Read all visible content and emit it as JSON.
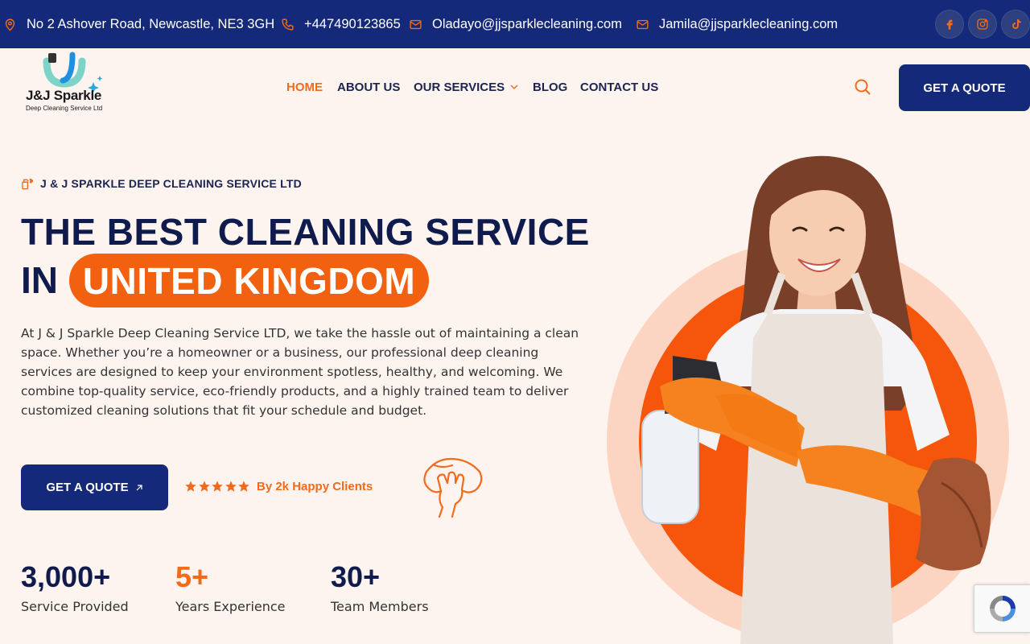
{
  "topbar": {
    "address": "No 2 Ashover Road, Newcastle, NE3 3GH",
    "phone": "+447490123865",
    "email1": "Oladayo@jjsparklecleaning.com",
    "email2": "Jamila@jjsparklecleaning.com",
    "social": [
      "facebook-icon",
      "instagram-icon",
      "tiktok-icon"
    ],
    "bg_color": "#14297a",
    "icon_color": "#f26a1b"
  },
  "logo": {
    "name": "J&J Sparkle",
    "subtitle": "Deep Cleaning Service Ltd"
  },
  "nav": {
    "items": [
      {
        "label": "HOME",
        "active": true
      },
      {
        "label": "ABOUT US",
        "active": false
      },
      {
        "label": "OUR SERVICES",
        "active": false,
        "dropdown": true
      },
      {
        "label": "BLOG",
        "active": false
      },
      {
        "label": "CONTACT US",
        "active": false
      }
    ],
    "cta": "GET A QUOTE"
  },
  "hero": {
    "tagline": "J & J SPARKLE DEEP CLEANING SERVICE LTD",
    "title_line1": "THE BEST CLEANING SERVICE",
    "title_line2_prefix": "IN",
    "title_highlight": "UNITED KINGDOM",
    "description": "At J & J Sparkle Deep Cleaning Service LTD, we take the hassle out of maintaining a clean space. Whether you’re a homeowner or a business, our professional deep cleaning services are designed to keep your environment spotless, healthy, and welcoming. We combine top-quality service, eco-friendly products, and a highly trained team to deliver customized cleaning solutions that fit your schedule and budget.",
    "cta": "GET A QUOTE",
    "rating_stars": 5,
    "rating_text": "By 2k Happy Clients",
    "accent_color": "#f2610f",
    "primary_color": "#14297a"
  },
  "stats": [
    {
      "value": "3,000+",
      "label": "Service Provided"
    },
    {
      "value": "5+",
      "label": "Years Experience"
    },
    {
      "value": "30+",
      "label": "Team Members"
    }
  ]
}
